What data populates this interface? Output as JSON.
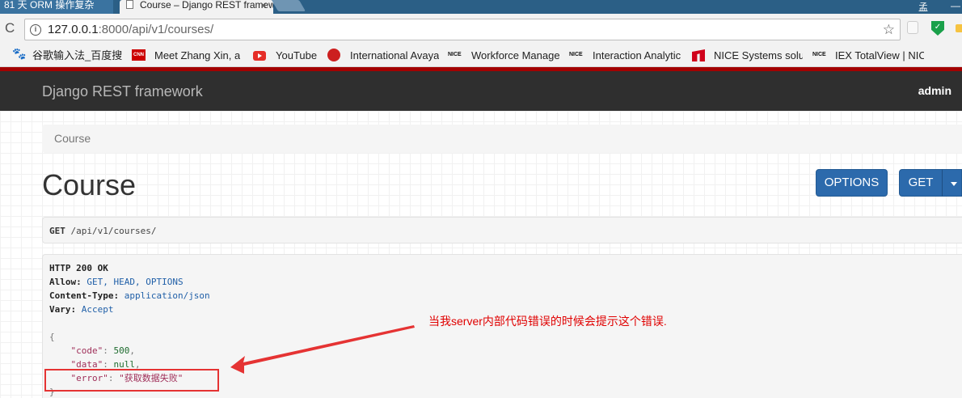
{
  "tabs": [
    {
      "label": "81 天 ORM 操作复杂",
      "active": false
    },
    {
      "label": "Course – Django REST framework",
      "active": true,
      "close": "×"
    }
  ],
  "window": {
    "user_label": "孟",
    "minimize": "—"
  },
  "address_bar": {
    "url_host": "127.0.0.1",
    "url_rest": ":8000/api/v1/courses/",
    "info_icon": "i",
    "star_icon": "☆",
    "reload_icon": "C"
  },
  "bookmarks": [
    {
      "label": "谷歌输入法_百度搜索",
      "icon": "paw-icon"
    },
    {
      "label": "Meet Zhang Xin, a",
      "icon": "cnn-icon",
      "icon_text": "CNN"
    },
    {
      "label": "YouTube",
      "icon": "youtube-icon"
    },
    {
      "label": "International Avaya",
      "icon": "avaya-icon"
    },
    {
      "label": "Workforce Manage",
      "icon": "nice-icon",
      "icon_text": "NICE"
    },
    {
      "label": "Interaction Analytic",
      "icon": "nice-icon",
      "icon_text": "NICE"
    },
    {
      "label": "NICE Systems solut",
      "icon": "red-logo-icon"
    },
    {
      "label": "IEX TotalView | NIC",
      "icon": "nice-icon",
      "icon_text": "NICE"
    }
  ],
  "navbar": {
    "brand": "Django REST framework",
    "user": "admin",
    "accent": "#a30000"
  },
  "breadcrumb": "Course",
  "page": {
    "title": "Course",
    "options_label": "OPTIONS",
    "get_label": "GET"
  },
  "request": {
    "method": "GET",
    "path": "/api/v1/courses/"
  },
  "response": {
    "status": "HTTP 200 OK",
    "headers": [
      {
        "name": "Allow:",
        "value": "GET, HEAD, OPTIONS"
      },
      {
        "name": "Content-Type:",
        "value": "application/json"
      },
      {
        "name": "Vary:",
        "value": "Accept"
      }
    ],
    "body": {
      "open": "{",
      "lines": [
        {
          "key": "\"code\"",
          "value": "500",
          "comma": ","
        },
        {
          "key": "\"data\"",
          "value": "null",
          "comma": ","
        },
        {
          "key": "\"error\"",
          "value": "\"获取数据失败\"",
          "comma": ""
        }
      ],
      "close": "}"
    }
  },
  "annotation": {
    "text": "当我server内部代码错误的时候会提示这个错误.",
    "color": "#e00000"
  }
}
